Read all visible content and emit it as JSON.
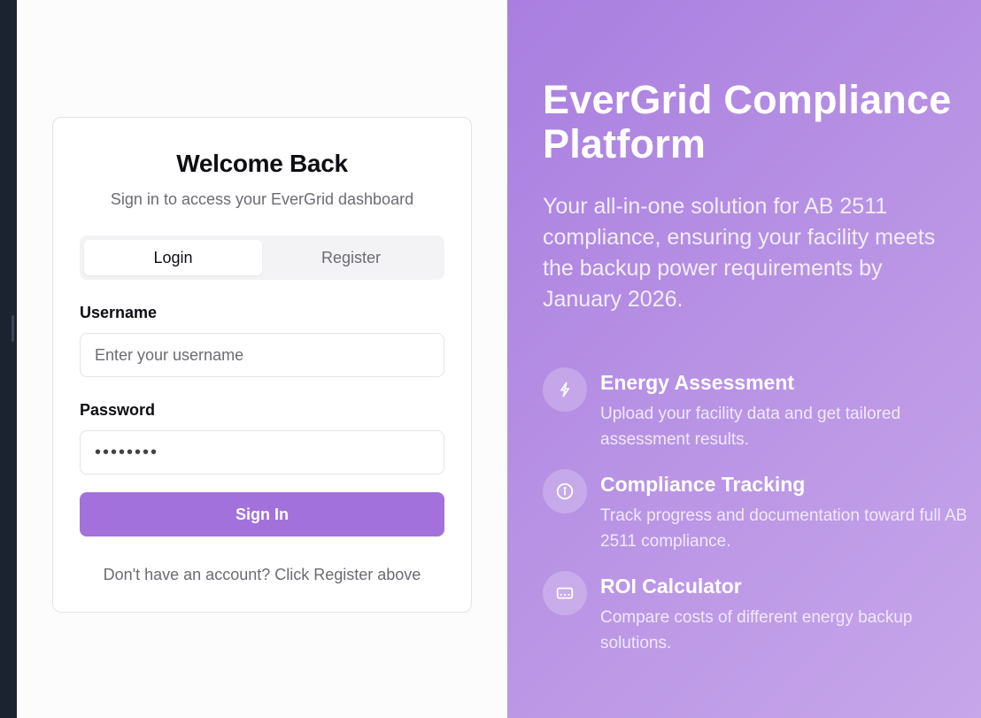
{
  "card": {
    "title": "Welcome Back",
    "subtitle": "Sign in to access your EverGrid dashboard"
  },
  "tabs": {
    "login": "Login",
    "register": "Register",
    "active": "Login"
  },
  "form": {
    "username_label": "Username",
    "username_placeholder": "Enter your username",
    "password_label": "Password",
    "password_value": "••••••••",
    "submit_label": "Sign In"
  },
  "footer_note": "Don't have an account? Click Register above",
  "hero": {
    "title": "EverGrid Compliance Platform",
    "description": "Your all-in-one solution for AB 2511 compliance, ensuring your facility meets the backup power requirements by January 2026."
  },
  "features": [
    {
      "icon": "bolt-icon",
      "title": "Energy Assessment",
      "description": "Upload your facility data and get tailored assessment results."
    },
    {
      "icon": "info-icon",
      "title": "Compliance Tracking",
      "description": "Track progress and documentation toward full AB 2511 compliance."
    },
    {
      "icon": "calculator-icon",
      "title": "ROI Calculator",
      "description": "Compare costs of different energy backup solutions."
    }
  ],
  "colors": {
    "accent": "#a371dc",
    "hero_gradient_start": "#a97ee0",
    "hero_gradient_end": "#c7a6ea"
  }
}
